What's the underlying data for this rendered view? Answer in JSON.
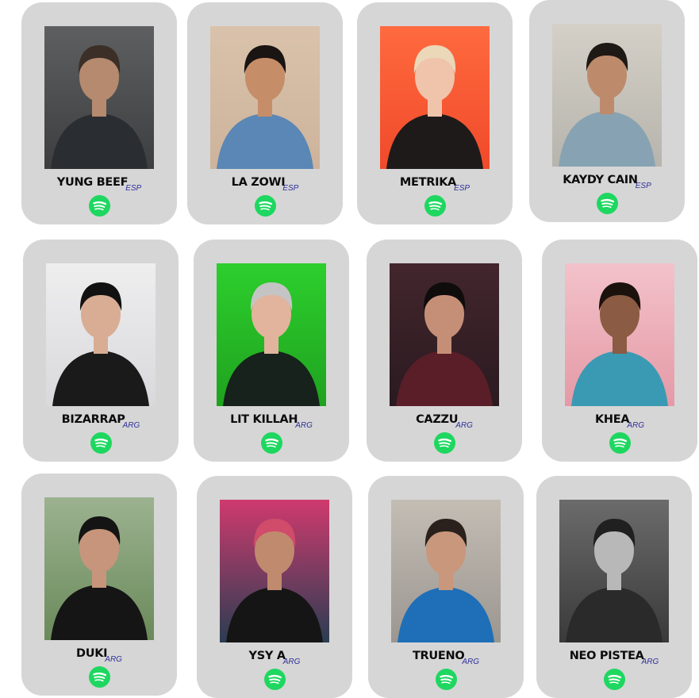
{
  "artists": [
    {
      "name": "YUNG BEEF",
      "tag": "ESP",
      "photo": {
        "bg": "#3c3e40",
        "top": "#5e5f60",
        "skin": "#b58a6f",
        "hair": "#3b2f27",
        "shirt": "#2a2d31"
      }
    },
    {
      "name": "LA ZOWI",
      "tag": "ESP",
      "photo": {
        "bg": "#cdb39b",
        "top": "#d9c2ab",
        "skin": "#c58d68",
        "hair": "#1a1412",
        "shirt": "#5a87b5"
      }
    },
    {
      "name": "METRIKA",
      "tag": "ESP",
      "photo": {
        "bg": "#f04a2a",
        "top": "#ff6a3f",
        "skin": "#f0c3ab",
        "hair": "#ead8b9",
        "shirt": "#1f1a1a"
      }
    },
    {
      "name": "KAYDY CAIN",
      "tag": "ESP",
      "photo": {
        "bg": "#b7b4ad",
        "top": "#d4d0c7",
        "skin": "#bd8b6c",
        "hair": "#1f1915",
        "shirt": "#87a3b3"
      }
    },
    {
      "name": "BIZARRAP",
      "tag": "ARG",
      "photo": {
        "bg": "#d9d9dc",
        "top": "#eeeeef",
        "skin": "#d8ad93",
        "hair": "#111111",
        "shirt": "#1a1a1a"
      }
    },
    {
      "name": "LIT KILLAH",
      "tag": "ARG",
      "photo": {
        "bg": "#1fa21f",
        "top": "#2dcf2d",
        "skin": "#e2b49d",
        "hair": "#c4c4c4",
        "shirt": "#16221b"
      }
    },
    {
      "name": "CAZZU",
      "tag": "ARG",
      "photo": {
        "bg": "#2a1a20",
        "top": "#43262d",
        "skin": "#c58f77",
        "hair": "#0f0c0c",
        "shirt": "#5a1e28"
      }
    },
    {
      "name": "KHEA",
      "tag": "ARG",
      "photo": {
        "bg": "#e49aa6",
        "top": "#f3c2ca",
        "skin": "#8b5b43",
        "hair": "#1b120d",
        "shirt": "#3a9ab3"
      }
    },
    {
      "name": "DUKI",
      "tag": "ARG",
      "photo": {
        "bg": "#6a8a5a",
        "top": "#9cb290",
        "skin": "#c7957b",
        "hair": "#141414",
        "shirt": "#151515"
      }
    },
    {
      "name": "YSY A",
      "tag": "ARG",
      "photo": {
        "bg": "#2a3d52",
        "top": "#cf3a6e",
        "skin": "#c08a6e",
        "hair": "#d14b6a",
        "shirt": "#151515"
      }
    },
    {
      "name": "TRUENO",
      "tag": "ARG",
      "photo": {
        "bg": "#9b9690",
        "top": "#c3bdb4",
        "skin": "#c9977c",
        "hair": "#2b211c",
        "shirt": "#1e6fb8"
      }
    },
    {
      "name": "NEO PISTEA",
      "tag": "ARG",
      "photo": {
        "bg": "#3a3a3a",
        "top": "#6b6b6b",
        "skin": "#b8b8b8",
        "hair": "#202020",
        "shirt": "#2a2a2a"
      }
    }
  ],
  "colors": {
    "card": "#d6d6d6",
    "spotify": "#1ed760",
    "tag": "#2f2f9b"
  },
  "icons": {
    "streaming": "spotify-icon"
  }
}
